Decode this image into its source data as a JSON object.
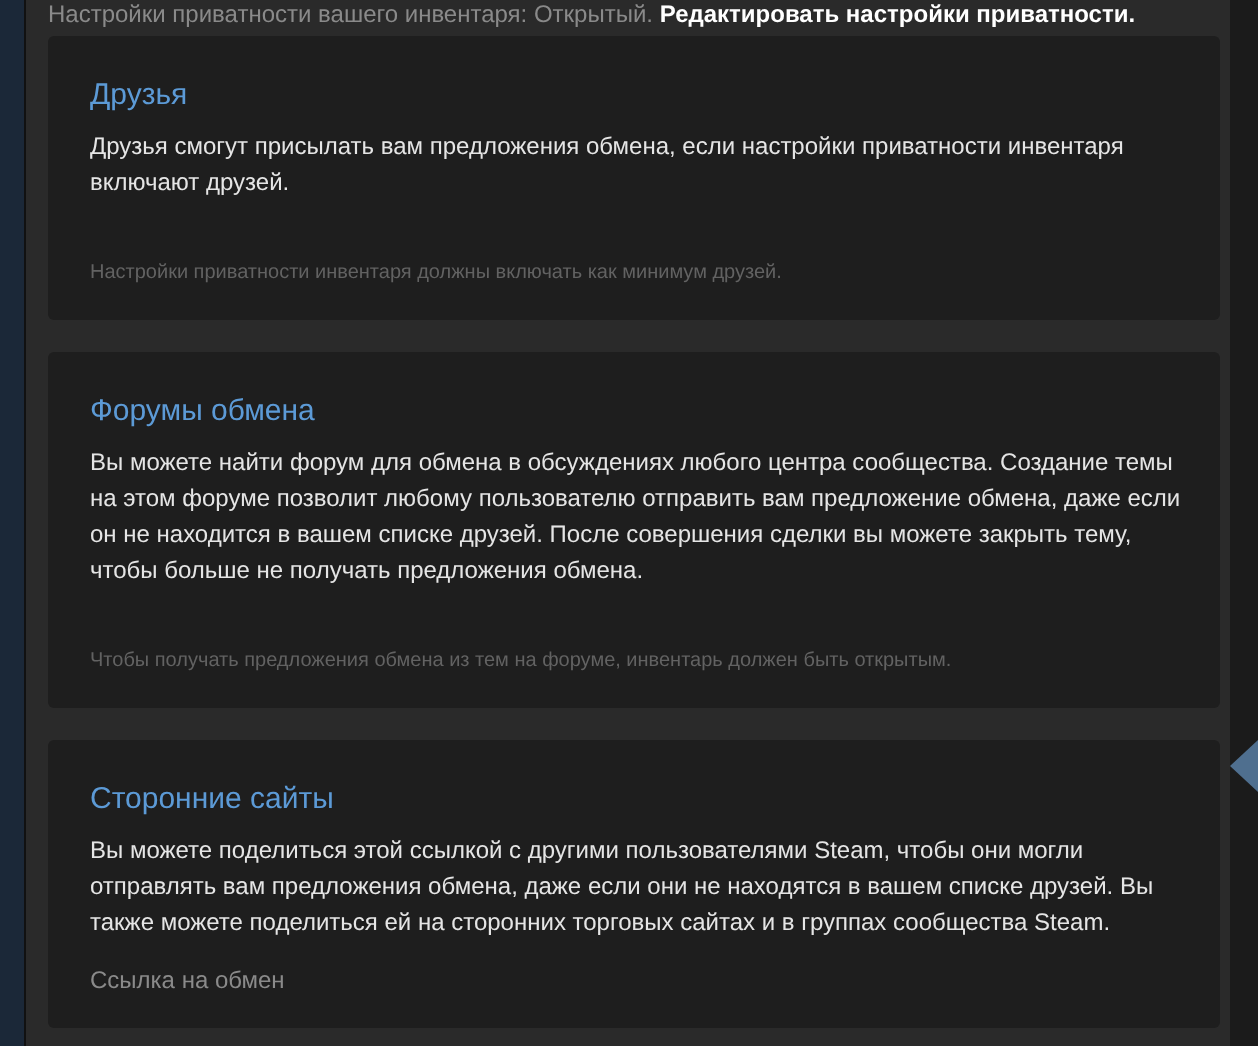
{
  "privacy_line": {
    "status": "Настройки приватности вашего инвентаря: Открытый.",
    "link": "Редактировать настройки приватности."
  },
  "sections": [
    {
      "title": "Друзья",
      "body": "Друзья смогут присылать вам предложения обмена, если настройки приватности инвентаря включают друзей.",
      "note": "Настройки приватности инвентаря должны включать как минимум друзей."
    },
    {
      "title": "Форумы обмена",
      "body": "Вы можете найти форум для обмена в обсуждениях любого центра сообщества. Создание темы на этом форуме позволит любому пользователю отправить вам предложение обмена, даже если он не находится в вашем списке друзей. После совершения сделки вы можете закрыть тему, чтобы больше не получать предложения обмена.",
      "note": "Чтобы получать предложения обмена из тем на форуме, инвентарь должен быть открытым."
    },
    {
      "title": "Сторонние сайты",
      "body": "Вы можете поделиться этой ссылкой с другими пользователями Steam, чтобы они могли отправлять вам предложения обмена, даже если они не находятся в вашем списке друзей. Вы также можете поделиться ей на сторонних торговых сайтах и в группах сообщества Steam.",
      "field_label": "Ссылка на обмен"
    }
  ]
}
